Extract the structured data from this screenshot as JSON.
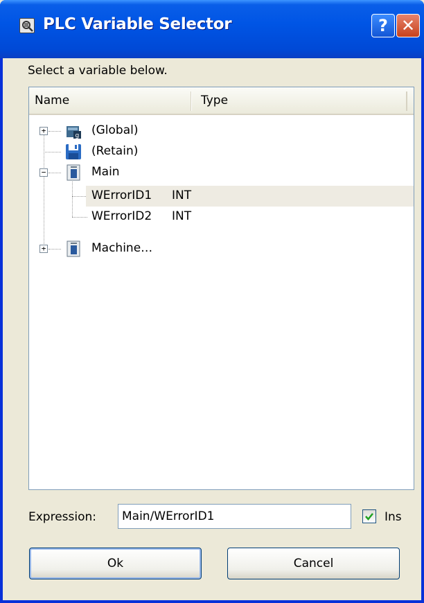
{
  "window": {
    "title": "PLC Variable Selector",
    "help_glyph": "?",
    "close_glyph": "✕"
  },
  "instruction": "Select a variable below.",
  "tree": {
    "columns": [
      "Name",
      "Type"
    ],
    "nodes": [
      {
        "label": "(Global)",
        "icon": "global-vars-icon",
        "expander": "+"
      },
      {
        "label": "(Retain)",
        "icon": "floppy-disk-icon",
        "expander": ""
      },
      {
        "label": "Main",
        "icon": "program-icon",
        "expander": "−",
        "children": [
          {
            "name": "WErrorID1",
            "type": "INT",
            "selected": true
          },
          {
            "name": "WErrorID2",
            "type": "INT",
            "selected": false
          }
        ]
      },
      {
        "label": "Machine…",
        "icon": "program-icon",
        "expander": "+"
      }
    ]
  },
  "expression": {
    "label": "Expression:",
    "value": "Main/WErrorID1"
  },
  "ins_checkbox": {
    "label": "Ins",
    "checked": true
  },
  "buttons": {
    "ok": "Ok",
    "cancel": "Cancel"
  },
  "colors": {
    "titlebar": "#0055e5",
    "window_border": "#0831d9",
    "selection": "#eeebe2"
  }
}
